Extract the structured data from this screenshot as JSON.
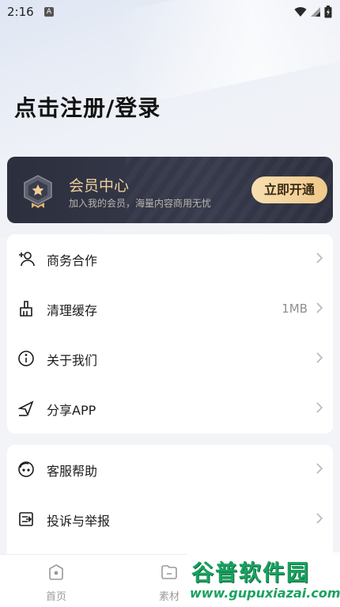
{
  "status_bar": {
    "time": "2:16",
    "notification_badge": "A"
  },
  "header": {
    "login_prompt": "点击注册/登录"
  },
  "vip": {
    "title": "会员中心",
    "subtitle": "加入我的会员，海量内容商用无忧",
    "cta_label": "立即开通",
    "accent": "#f0cf9c"
  },
  "menu_group_1": [
    {
      "label": "商务合作",
      "icon": "add-user-icon",
      "value": ""
    },
    {
      "label": "清理缓存",
      "icon": "broom-icon",
      "value": "1MB"
    },
    {
      "label": "关于我们",
      "icon": "info-icon",
      "value": ""
    },
    {
      "label": "分享APP",
      "icon": "share-icon",
      "value": ""
    }
  ],
  "menu_group_2": [
    {
      "label": "客服帮助",
      "icon": "customer-service-icon",
      "value": ""
    },
    {
      "label": "投诉与举报",
      "icon": "report-icon",
      "value": ""
    }
  ],
  "bottom_nav": [
    {
      "label": "首页",
      "icon": "home-icon"
    },
    {
      "label": "素材",
      "icon": "folder-icon"
    }
  ],
  "watermark": {
    "brand": "谷普软件园",
    "url": "www.gupuxiazai.com"
  }
}
